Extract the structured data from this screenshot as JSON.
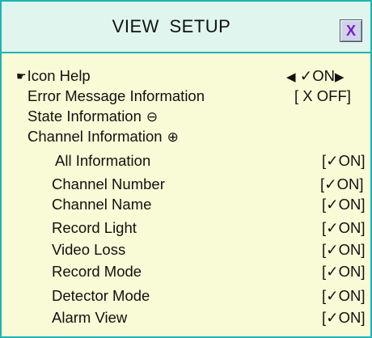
{
  "window": {
    "title": "VIEW   SETUP",
    "close_label": "X"
  },
  "colors": {
    "border": "#1fb3b6",
    "title_bg": "#dff5ee",
    "body_bg": "#f9fad6",
    "close_x": "#7a1ad8"
  },
  "rows": [
    {
      "label": "Icon Help",
      "value_prefix": "◀",
      "value": "✓ON",
      "value_suffix": "▶",
      "selected": true,
      "pointer_icon": "pointing-hand-icon"
    },
    {
      "label": "Error Message Information",
      "value": "[ X OFF]"
    },
    {
      "label": "State Information",
      "symbol": "⊖",
      "symbol_icon": "collapse-circle-icon"
    },
    {
      "label": "Channel Information",
      "symbol": "⊕",
      "symbol_icon": "expand-circle-icon"
    },
    {
      "label": "All Information",
      "value": "[✓ON]"
    },
    {
      "label": "Channel Number",
      "value": "[✓ON]"
    },
    {
      "label": "Channel Name",
      "value": "[✓ON]"
    },
    {
      "label": "Record Light",
      "value": "[✓ON]"
    },
    {
      "label": "Video Loss",
      "value": "[✓ON]"
    },
    {
      "label": "Record Mode",
      "value": "[✓ON]"
    },
    {
      "label": "Detector Mode",
      "value": "[✓ON]"
    },
    {
      "label": "Alarm View",
      "value": "[✓ON]"
    }
  ]
}
